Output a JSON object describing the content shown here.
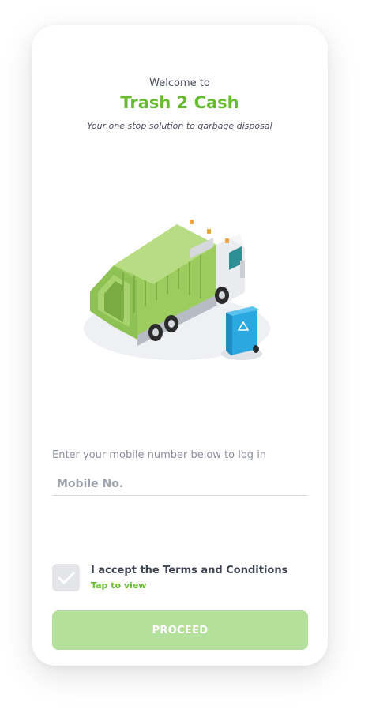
{
  "header": {
    "welcome": "Welcome to",
    "app_name": "Trash 2 Cash",
    "tagline": "Your one stop solution to garbage disposal"
  },
  "illustration": {
    "icon": "garbage-truck-illustration",
    "truck_color": "#8fc255",
    "bin_color": "#2aa8df"
  },
  "login": {
    "hint": "Enter your mobile number below to log in",
    "mobile_placeholder": "Mobile No.",
    "mobile_value": ""
  },
  "terms": {
    "checked": false,
    "label": "I accept the Terms and Conditions",
    "link": "Tap to view"
  },
  "actions": {
    "proceed_label": "PROCEED"
  },
  "colors": {
    "brand": "#66bb2e",
    "button_disabled": "#b3e09a",
    "text_dark": "#4a4f5c"
  }
}
